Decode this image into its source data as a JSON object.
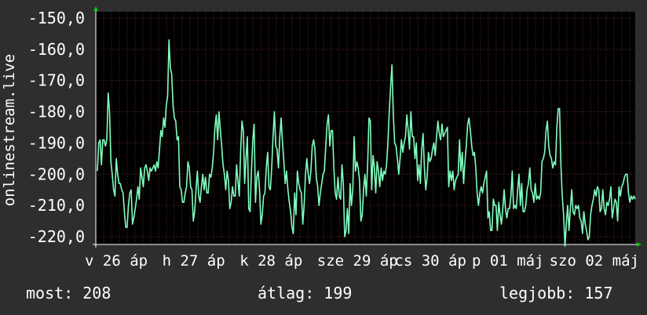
{
  "chart_data": {
    "type": "line",
    "ylabel": "onlinestream.live",
    "ylim": [
      -222.5,
      -148
    ],
    "yticks": [
      -150,
      -160,
      -170,
      -180,
      -190,
      -200,
      -210,
      -220
    ],
    "ytick_labels": [
      "-150,0",
      "-160,0",
      "-170,0",
      "-180,0",
      "-190,0",
      "-200,0",
      "-210,0",
      "-220,0"
    ],
    "xtick_labels": [
      "v 26 áp",
      "h 27 áp",
      "k 28 áp",
      "sze 29 áp",
      "cs 30 áp",
      "p 01 máj",
      "szo 02 máj"
    ],
    "grid": true,
    "colors": {
      "background": "#2e2e2e",
      "plot_background": "#000000",
      "grid": "#5a2a2a",
      "line": "#7fffc0",
      "arrow": "#00d000",
      "text": "#ffffff"
    },
    "series": [
      {
        "values": [
          -199,
          -190,
          -189,
          -197,
          -189,
          -189,
          -191,
          -189,
          -174,
          -180,
          -196,
          -200,
          -205,
          -207,
          -195,
          -200,
          -203,
          -203,
          -205,
          -206,
          -212,
          -217,
          -217,
          -210,
          -206,
          -205,
          -216,
          -214,
          -211,
          -208,
          -204,
          -208,
          -198,
          -201,
          -204,
          -198,
          -197,
          -199,
          -202,
          -198,
          -199,
          -198,
          -197,
          -199,
          -196,
          -198,
          -192,
          -186,
          -188,
          -182,
          -185,
          -178,
          -175,
          -157,
          -166,
          -168,
          -178,
          -182,
          -183,
          -189,
          -188,
          -204,
          -205,
          -209,
          -209,
          -206,
          -204,
          -196,
          -198,
          -204,
          -205,
          -215,
          -212,
          -205,
          -199,
          -207,
          -209,
          -204,
          -200,
          -205,
          -201,
          -206,
          -206,
          -200,
          -201,
          -198,
          -193,
          -185,
          -181,
          -189,
          -180,
          -186,
          -191,
          -197,
          -200,
          -205,
          -199,
          -202,
          -211,
          -209,
          -204,
          -207,
          -207,
          -197,
          -202,
          -207,
          -193,
          -183,
          -186,
          -203,
          -195,
          -188,
          -211,
          -212,
          -199,
          -189,
          -184,
          -209,
          -201,
          -199,
          -205,
          -216,
          -213,
          -207,
          -206,
          -198,
          -193,
          -204,
          -205,
          -198,
          -188,
          -180,
          -191,
          -192,
          -198,
          -188,
          -182,
          -190,
          -196,
          -203,
          -199,
          -205,
          -209,
          -212,
          -217,
          -219,
          -206,
          -213,
          -199,
          -203,
          -205,
          -206,
          -216,
          -210,
          -200,
          -195,
          -200,
          -203,
          -199,
          -191,
          -189,
          -192,
          -201,
          -204,
          -210,
          -206,
          -203,
          -200,
          -199,
          -191,
          -184,
          -181,
          -191,
          -186,
          -186,
          -198,
          -206,
          -208,
          -201,
          -207,
          -208,
          -197,
          -203,
          -220,
          -218,
          -211,
          -219,
          -203,
          -210,
          -205,
          -188,
          -199,
          -196,
          -198,
          -202,
          -215,
          -213,
          -205,
          -200,
          -207,
          -197,
          -182,
          -183,
          -205,
          -194,
          -198,
          -206,
          -196,
          -199,
          -204,
          -198,
          -202,
          -199,
          -200,
          -197,
          -190,
          -180,
          -172,
          -165,
          -181,
          -190,
          -191,
          -195,
          -200,
          -195,
          -189,
          -193,
          -190,
          -188,
          -181,
          -186,
          -192,
          -180,
          -188,
          -188,
          -195,
          -190,
          -202,
          -197,
          -203,
          -192,
          -187,
          -198,
          -205,
          -201,
          -193,
          -196,
          -195,
          -192,
          -190,
          -194,
          -188,
          -183,
          -187,
          -189,
          -184,
          -188,
          -187,
          -186,
          -185,
          -204,
          -199,
          -202,
          -199,
          -205,
          -202,
          -201,
          -200,
          -189,
          -199,
          -193,
          -203,
          -196,
          -191,
          -184,
          -182,
          -186,
          -191,
          -194,
          -193,
          -198,
          -206,
          -210,
          -206,
          -204,
          -206,
          -203,
          -201,
          -199,
          -214,
          -212,
          -218,
          -218,
          -208,
          -210,
          -210,
          -218,
          -209,
          -213,
          -216,
          -211,
          -205,
          -211,
          -214,
          -211,
          -211,
          -207,
          -199,
          -211,
          -210,
          -211,
          -205,
          -200,
          -210,
          -203,
          -212,
          -212,
          -210,
          -205,
          -203,
          -198,
          -205,
          -206,
          -209,
          -203,
          -208,
          -207,
          -208,
          -206,
          -196,
          -195,
          -193,
          -186,
          -183,
          -191,
          -194,
          -195,
          -198,
          -196,
          -197,
          -185,
          -179,
          -179,
          -197,
          -207,
          -213,
          -223,
          -216,
          -210,
          -218,
          -211,
          -205,
          -212,
          -213,
          -210,
          -211,
          -210,
          -214,
          -215,
          -219,
          -212,
          -216,
          -218,
          -221,
          -220,
          -213,
          -210,
          -208,
          -205,
          -207,
          -204,
          -205,
          -212,
          -211,
          -205,
          -211,
          -213,
          -209,
          -210,
          -208,
          -204,
          -214,
          -211,
          -208,
          -209,
          -215,
          -204,
          -207,
          -204,
          -203,
          -201,
          -200,
          -200,
          -206,
          -209,
          -207,
          -208,
          -207,
          -208
        ]
      }
    ]
  },
  "stats": {
    "current": "most: 208",
    "average": "átlag: 199",
    "best": "legjobb: 157"
  }
}
